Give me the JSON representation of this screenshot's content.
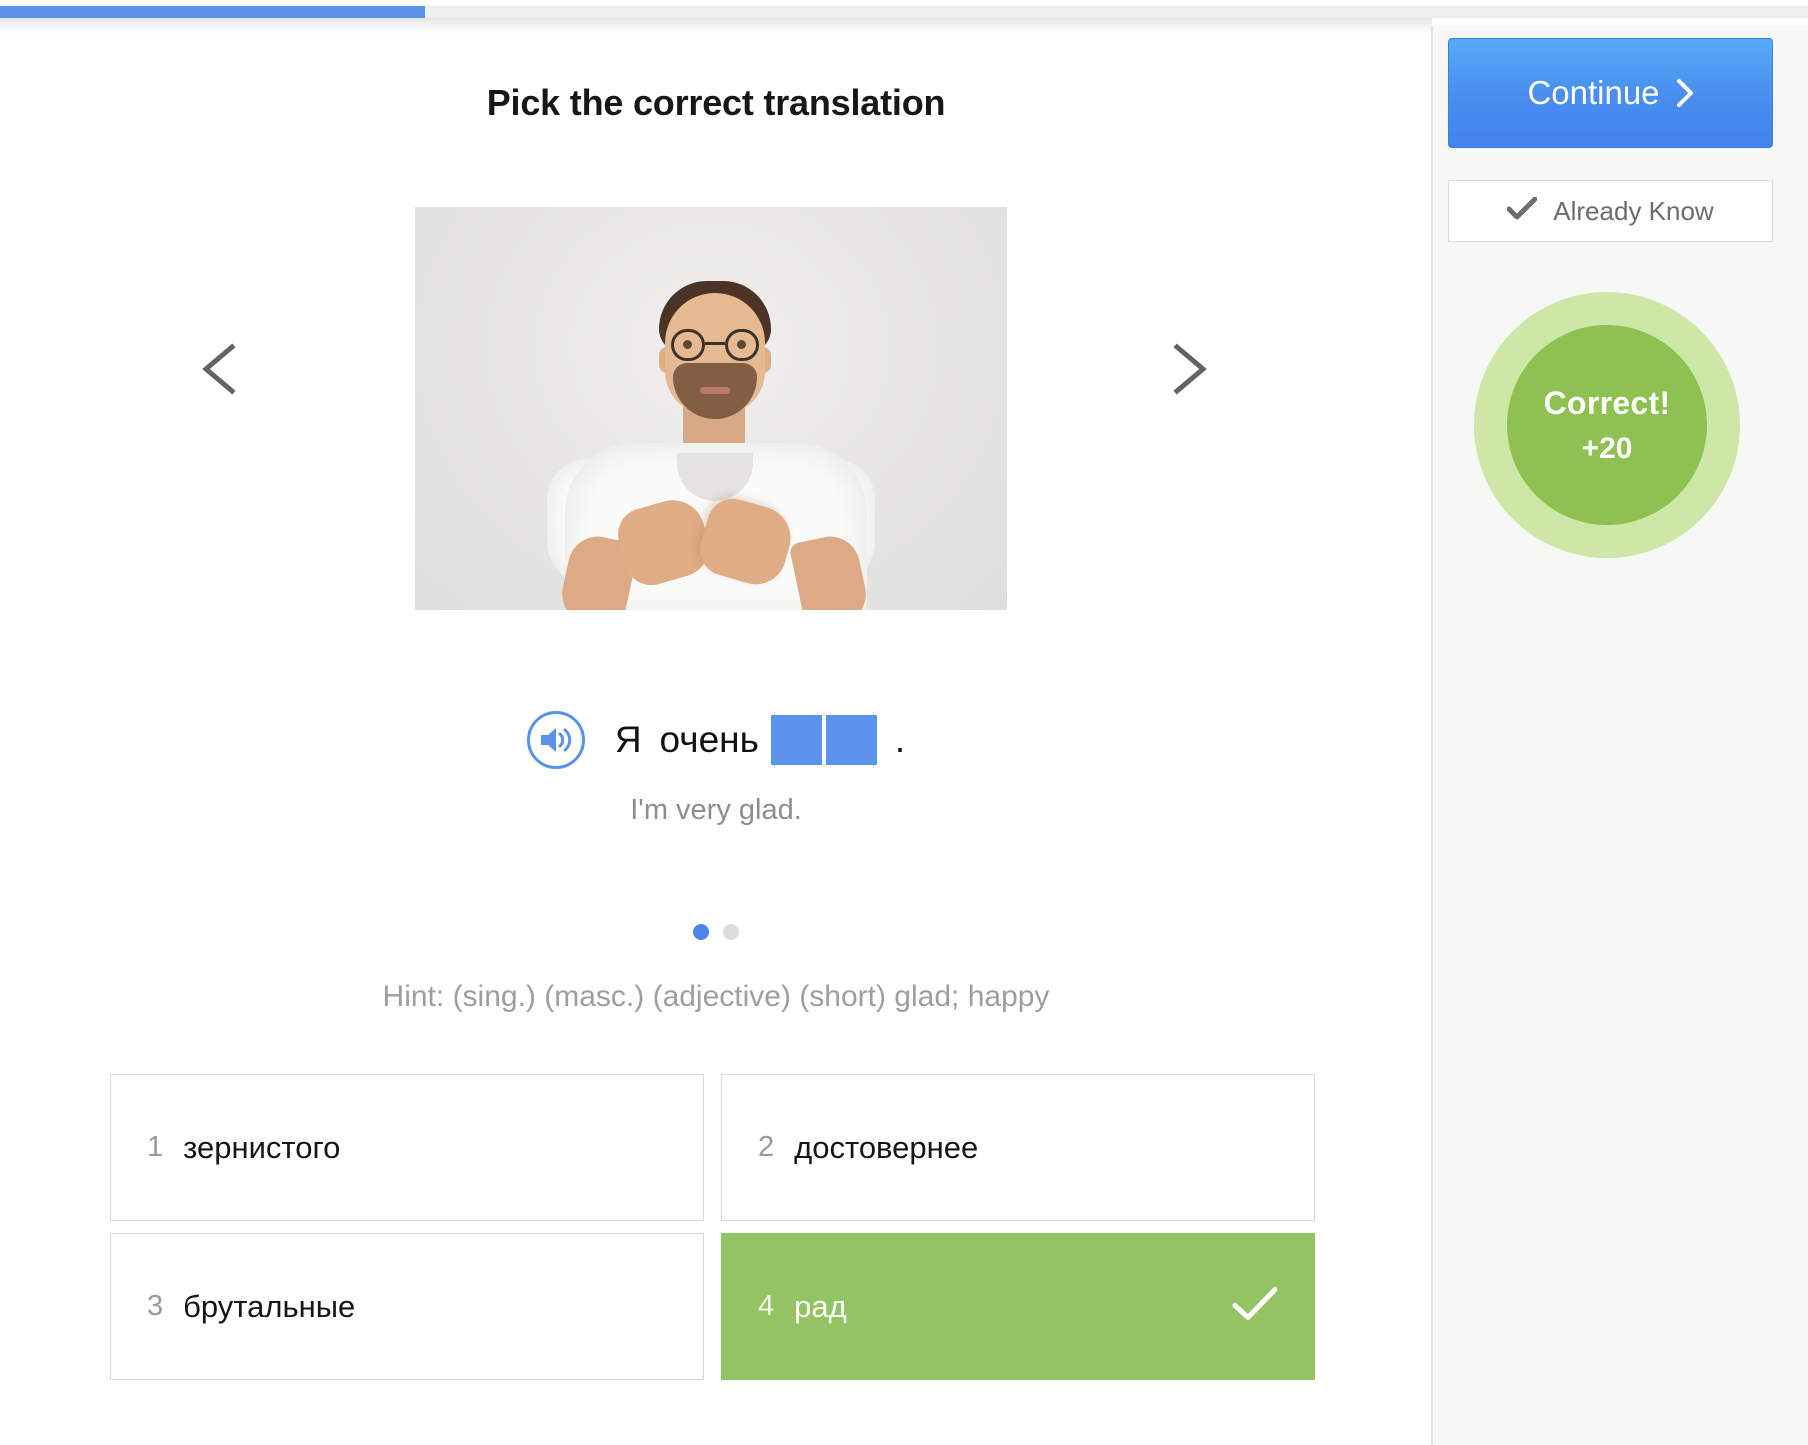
{
  "progress": {
    "percent": 23.5,
    "fill_color": "#5b92ec",
    "track_color": "#efefef"
  },
  "header": {
    "title": "Pick the correct translation"
  },
  "carousel": {
    "prev_label": "Previous",
    "next_label": "Next",
    "image_alt": "Smiling bearded man with glasses in a white t-shirt holding both hands on his chest"
  },
  "exercise": {
    "audio_label": "Play audio",
    "sentence_prefix": "Я",
    "sentence_word": "очень",
    "blank_count": 2,
    "sentence_suffix": ".",
    "translation": "I'm very glad.",
    "hint": "Hint: (sing.) (masc.) (adjective) (short) glad; happy",
    "blank_color": "#5b92ec",
    "pager": {
      "total": 2,
      "active_index": 0
    }
  },
  "answers": [
    {
      "index": "1",
      "label": "зернистого",
      "correct": false
    },
    {
      "index": "2",
      "label": "достовернее",
      "correct": false
    },
    {
      "index": "3",
      "label": "брутальные",
      "correct": false
    },
    {
      "index": "4",
      "label": "рад",
      "correct": true
    }
  ],
  "sidebar": {
    "continue_label": "Continue",
    "already_know_label": "Already Know",
    "score": {
      "title": "Correct!",
      "points": "+20",
      "circle_color": "#8dc152",
      "halo_color": "#cde8a6"
    }
  }
}
